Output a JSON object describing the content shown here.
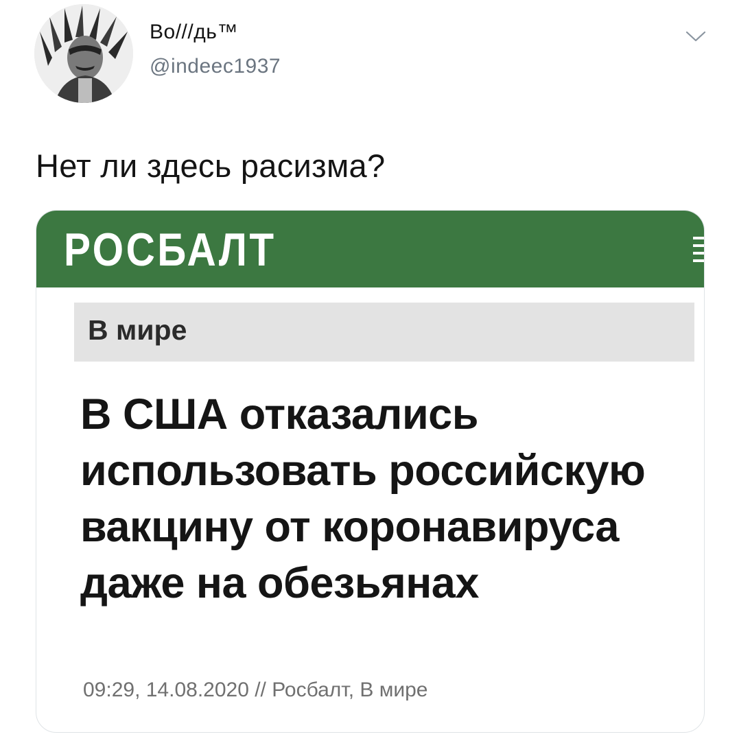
{
  "tweet": {
    "display_name": "Во///дь™",
    "handle": "@indeec1937",
    "text": "Нет ли здесь расизма?",
    "menu_icon": "chevron-down-icon"
  },
  "embedded_article": {
    "site_name": "РОСБАЛТ",
    "menu_icon": "hamburger-menu-icon",
    "header_color": "#3c7841",
    "category": "В мире",
    "headline": "В США отказались использовать российскую вакцину от коронавируса даже на обезьянах",
    "meta": "09:29, 14.08.2020 // Росбалт, В мире"
  }
}
